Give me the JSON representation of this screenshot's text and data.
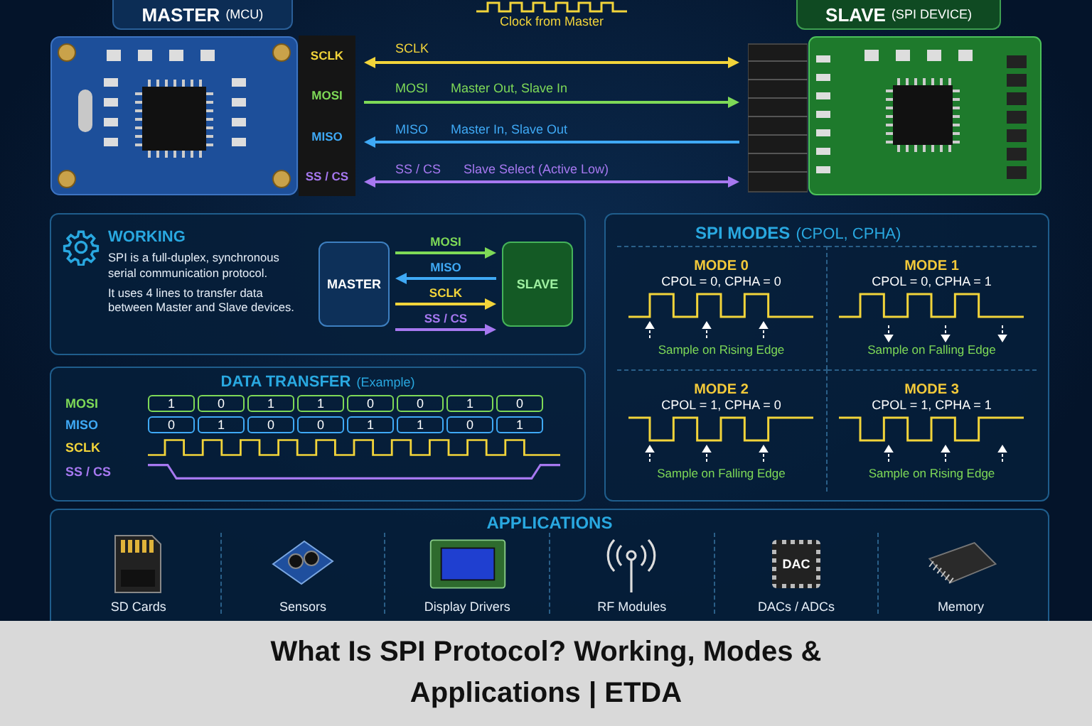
{
  "master": {
    "title": "MASTER",
    "subtitle": "(MCU)",
    "pins": [
      {
        "label": "SCLK",
        "color": "#f2d43a"
      },
      {
        "label": "MOSI",
        "color": "#7ed957"
      },
      {
        "label": "MISO",
        "color": "#3fa9f5"
      },
      {
        "label": "SS / CS",
        "color": "#a678f0"
      }
    ]
  },
  "clock_label": "Clock from Master",
  "slave": {
    "title": "SLAVE",
    "subtitle": "(SPI DEVICE)"
  },
  "signals": [
    {
      "name": "SCLK",
      "color": "#f2d43a",
      "head_left": true,
      "head_right": true
    },
    {
      "name": "MOSI",
      "description": "Master Out, Slave In",
      "color": "#7ed957",
      "head_left": false,
      "head_right": true
    },
    {
      "name": "MISO",
      "description": "Master In, Slave Out",
      "color": "#3fa9f5",
      "head_left": true,
      "head_right": false
    },
    {
      "name": "SS / CS",
      "description": "Slave Select (Active Low)",
      "color": "#a678f0",
      "head_left": true,
      "head_right": true
    }
  ],
  "working": {
    "title": "WORKING",
    "paragraphs": [
      "SPI is a full-duplex, synchronous serial communication protocol.",
      "It uses 4 lines to transfer data between Master and Slave devices."
    ],
    "master_label": "MASTER",
    "slave_label": "SLAVE",
    "lines": [
      {
        "name": "MOSI",
        "color": "#7ed957",
        "head_left": false,
        "head_right": true
      },
      {
        "name": "MISO",
        "color": "#3fa9f5",
        "head_left": true,
        "head_right": false
      },
      {
        "name": "SCLK",
        "color": "#f2d43a",
        "head_left": false,
        "head_right": true
      },
      {
        "name": "SS / CS",
        "color": "#a678f0",
        "head_left": false,
        "head_right": true
      }
    ]
  },
  "data_transfer": {
    "title": "DATA TRANSFER",
    "title_note": "(Example)",
    "rows": [
      {
        "name": "MOSI",
        "color": "#7ed957",
        "bits": [
          "1",
          "0",
          "1",
          "1",
          "0",
          "0",
          "1",
          "0"
        ]
      },
      {
        "name": "MISO",
        "color": "#3fa9f5",
        "bits": [
          "0",
          "1",
          "0",
          "0",
          "1",
          "1",
          "0",
          "1"
        ]
      }
    ],
    "clock_label": "SCLK",
    "select_label": "SS / CS"
  },
  "modes": {
    "title": "SPI MODES",
    "title_note": "(CPOL, CPHA)",
    "items": [
      {
        "name": "MODE 0",
        "params": "CPOL = 0, CPHA = 0",
        "idle_high": false,
        "sample_trailing": false,
        "arrow_down": false,
        "caption": "Sample on Rising Edge"
      },
      {
        "name": "MODE 1",
        "params": "CPOL = 0, CPHA = 1",
        "idle_high": false,
        "sample_trailing": true,
        "arrow_down": true,
        "caption": "Sample on Falling Edge"
      },
      {
        "name": "MODE 2",
        "params": "CPOL = 1, CPHA = 0",
        "idle_high": true,
        "sample_trailing": false,
        "arrow_down": false,
        "caption": "Sample on Falling Edge"
      },
      {
        "name": "MODE 3",
        "params": "CPOL = 1, CPHA = 1",
        "idle_high": true,
        "sample_trailing": true,
        "arrow_down": false,
        "caption": "Sample on Rising Edge"
      }
    ]
  },
  "applications": {
    "title": "APPLICATIONS",
    "items": [
      {
        "label": "SD Cards",
        "kind": "sd-card"
      },
      {
        "label": "Sensors",
        "kind": "sensor"
      },
      {
        "label": "Display Drivers",
        "kind": "display"
      },
      {
        "label": "RF Modules",
        "kind": "antenna"
      },
      {
        "label": "DACs / ADCs",
        "kind": "chip",
        "chip_label": "DAC"
      },
      {
        "label": "Memory",
        "kind": "memory"
      }
    ]
  },
  "caption": "What Is SPI Protocol? Working, Modes & Applications | ETDA"
}
